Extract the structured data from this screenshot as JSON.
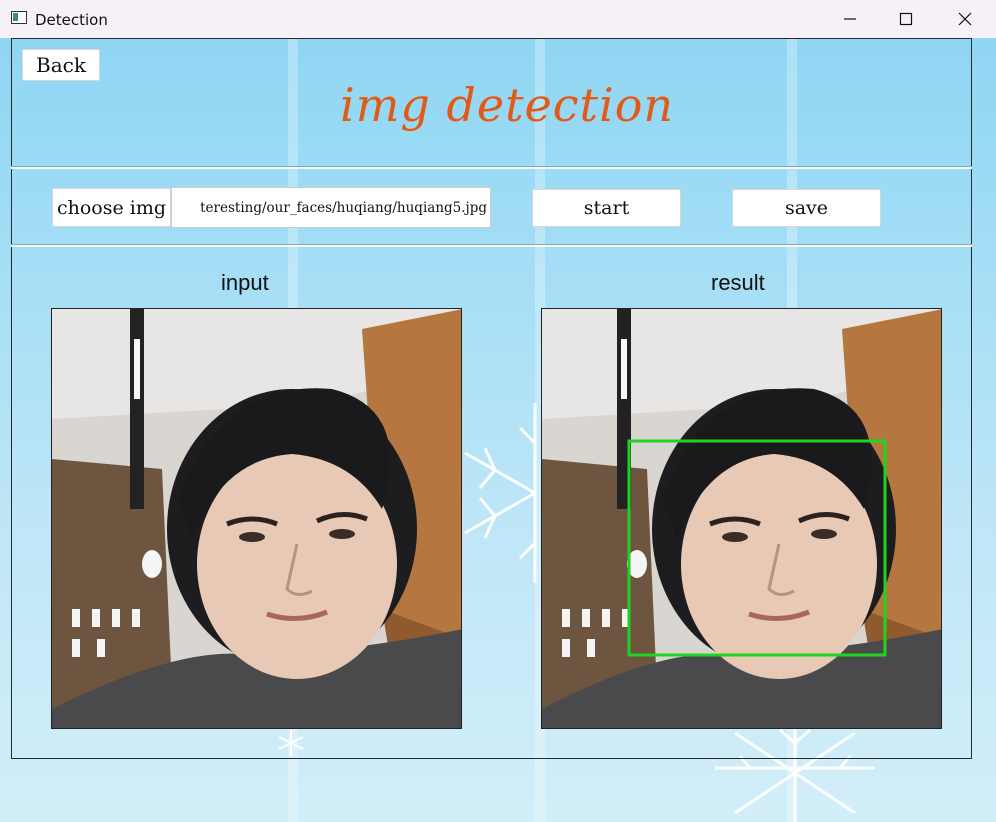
{
  "window": {
    "title": "Detection"
  },
  "header": {
    "back_label": "Back",
    "heading": "img detection"
  },
  "controls": {
    "choose_label": "choose img",
    "path_value": "teresting/our_faces/huqiang/huqiang5.jpg",
    "start_label": "start",
    "save_label": "save"
  },
  "panels": {
    "input_label": "input",
    "result_label": "result"
  },
  "detection": {
    "box_color": "#1ed41e"
  },
  "icons": [
    "app-icon",
    "minimize-icon",
    "maximize-icon",
    "close-icon",
    "snowflake-icon"
  ]
}
